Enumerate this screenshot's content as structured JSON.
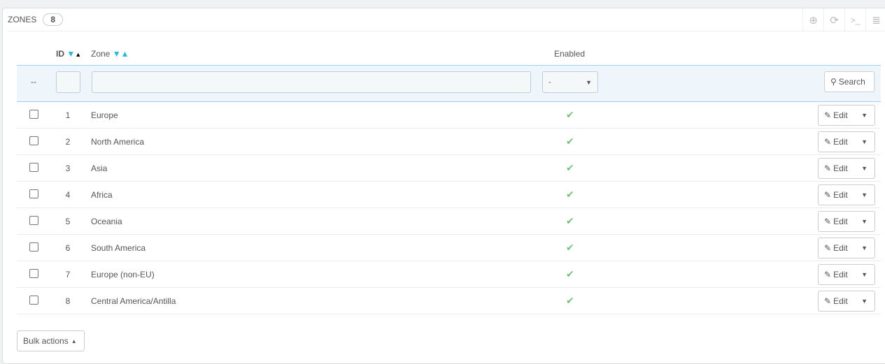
{
  "panel": {
    "title": "Zones",
    "count": "8"
  },
  "toolbar": {
    "add": "plus-circle-icon",
    "refresh": "refresh-icon",
    "sql": "terminal-icon",
    "export": "database-icon"
  },
  "columns": {
    "id": "ID",
    "zone": "Zone",
    "enabled": "Enabled"
  },
  "filters": {
    "placeholder_dash": "--",
    "enabled_select": "-",
    "search_label": "Search"
  },
  "rows": [
    {
      "id": "1",
      "zone": "Europe",
      "enabled": true
    },
    {
      "id": "2",
      "zone": "North America",
      "enabled": true
    },
    {
      "id": "3",
      "zone": "Asia",
      "enabled": true
    },
    {
      "id": "4",
      "zone": "Africa",
      "enabled": true
    },
    {
      "id": "5",
      "zone": "Oceania",
      "enabled": true
    },
    {
      "id": "6",
      "zone": "South America",
      "enabled": true
    },
    {
      "id": "7",
      "zone": "Europe (non-EU)",
      "enabled": true
    },
    {
      "id": "8",
      "zone": "Central America/Antilla",
      "enabled": true
    }
  ],
  "row_action": "Edit",
  "bulk_actions": "Bulk actions",
  "colors": {
    "accent": "#25b9d7",
    "enabled": "#72c279",
    "filter_bg": "#eef6fc"
  }
}
